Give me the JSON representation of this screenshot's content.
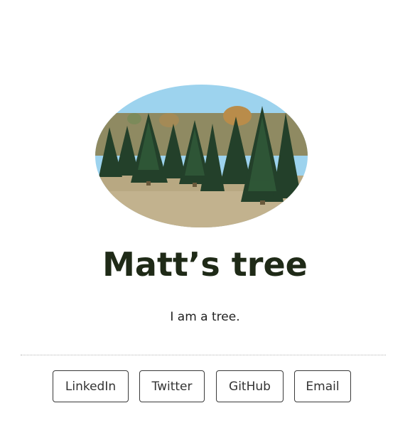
{
  "profile": {
    "title": "Matt’s tree",
    "tagline": "I am a tree.",
    "avatar_alt": "photo of evergreen trees"
  },
  "links": [
    {
      "label": "LinkedIn"
    },
    {
      "label": "Twitter"
    },
    {
      "label": "GitHub"
    },
    {
      "label": "Email"
    }
  ],
  "colors": {
    "title": "#1f2a17",
    "text": "#222222",
    "button_border": "#3a3a3a",
    "divider": "#b5b5b5",
    "sky": "#9dd3ee",
    "tree": "#23402a",
    "ground": "#b8a882"
  }
}
